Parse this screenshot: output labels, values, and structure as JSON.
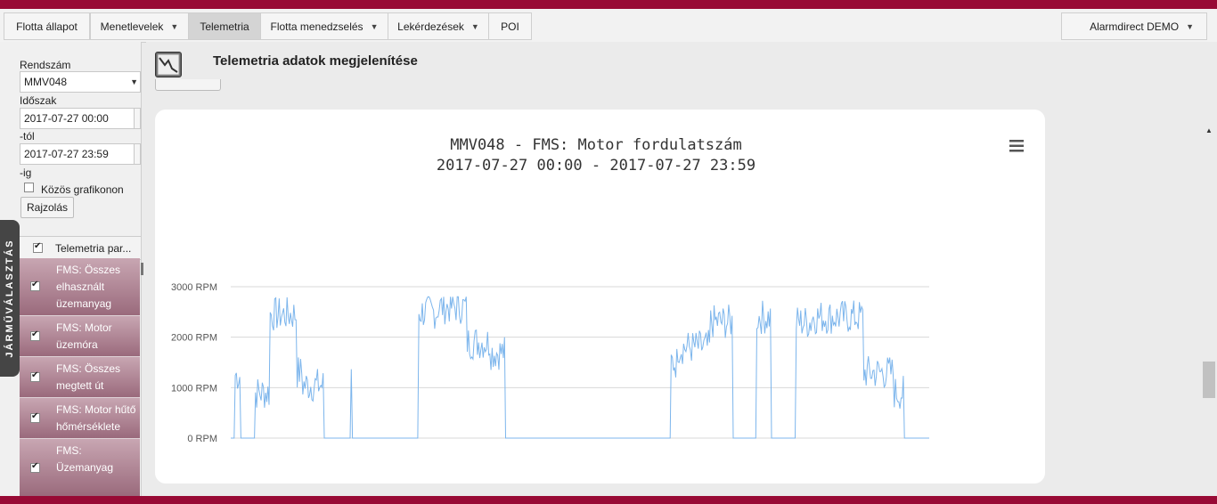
{
  "nav": {
    "items": [
      {
        "label": "Flotta állapot",
        "dropdown": false
      },
      {
        "label": "Menetlevelek",
        "dropdown": true
      },
      {
        "label": "Telemetria",
        "dropdown": false,
        "active": true
      },
      {
        "label": "Flotta menedzselés",
        "dropdown": true
      },
      {
        "label": "Lekérdezések",
        "dropdown": true
      },
      {
        "label": "POI",
        "dropdown": false
      }
    ],
    "user_label": "Alarmdirect DEMO",
    "caret": "▼"
  },
  "sidebar": {
    "tab_label": "JÁRMŰVÁLASZTÁS",
    "plate_label": "Rendszám",
    "plate_value": "MMV048",
    "period_label": "Időszak",
    "from_value": "2017-07-27 00:00",
    "from_suffix": "-tól",
    "to_value": "2017-07-27 23:59",
    "to_suffix": "-ig",
    "common_chart_label": "Közös grafikonon",
    "common_chart_checked": false,
    "draw_button": "Rajzolás",
    "table_header": "Telemetria par...",
    "params": [
      {
        "label": "FMS: Összes elhasznált üzemanyag",
        "checked": true
      },
      {
        "label": "FMS: Motor üzemóra",
        "checked": true
      },
      {
        "label": "FMS: Összes megtett út",
        "checked": true
      },
      {
        "label": "FMS: Motor hűtő hőmérséklete",
        "checked": true
      },
      {
        "label": "FMS: Üzemanyag",
        "checked": true
      }
    ]
  },
  "main": {
    "page_title": "Telemetria adatok megjelenítése",
    "page_icon": "telemetry-chart-icon"
  },
  "colors": {
    "brand": "#980a35",
    "series": "#7cb5ec",
    "param_row": "#a77a8b"
  },
  "chart_data": {
    "type": "line",
    "title": "MMV048 - FMS: Motor fordulatszám",
    "subtitle": "2017-07-27 00:00 - 2017-07-27 23:59",
    "y_unit": "RPM",
    "y_ticks": [
      0,
      1000,
      2000,
      3000
    ],
    "y_tick_labels": [
      "0 RPM",
      "1000 RPM",
      "2000 RPM",
      "3000 RPM"
    ],
    "ylim": [
      0,
      3000
    ],
    "xlim": [
      0,
      100
    ],
    "grid": true,
    "menu_icon": "hamburger-menu-icon",
    "series": [
      {
        "x": [
          0.0,
          0.13,
          0.38,
          0.52,
          0.78,
          0.91,
          1.17,
          1.3,
          1.43,
          1.69,
          1.82,
          2.08,
          2.34,
          2.47,
          2.6,
          2.86,
          2.99,
          3.25,
          3.38,
          3.51,
          3.64,
          3.9,
          4.16,
          4.29,
          4.42,
          4.68,
          4.81,
          4.94,
          5.07,
          5.2,
          5.32,
          5.45,
          5.58,
          5.71,
          5.84,
          5.97,
          6.1,
          6.23,
          6.36,
          6.49,
          6.62,
          6.75,
          6.88,
          7.01,
          7.14,
          7.27,
          7.4,
          7.53,
          7.66,
          7.79,
          7.92,
          8.05,
          8.18,
          8.31,
          8.44,
          8.57,
          8.7,
          8.83,
          8.96,
          9.09,
          9.22,
          9.35,
          9.48,
          9.61,
          9.74,
          9.87,
          10.0,
          10.26,
          10.39,
          10.52,
          10.65,
          10.78,
          10.91,
          11.04,
          11.17,
          11.3,
          11.43,
          11.56,
          11.69,
          11.82,
          11.95,
          12.08,
          12.21,
          12.34,
          12.47,
          12.6,
          12.73,
          12.86,
          13.12,
          13.25,
          13.38,
          13.51,
          13.64,
          13.77,
          13.9,
          14.16,
          14.29,
          14.42,
          14.55,
          14.68,
          14.81,
          14.94,
          15.19,
          15.32,
          15.45,
          15.58,
          15.71,
          15.84,
          16.23,
          16.88,
          17.53,
          18.18,
          18.83,
          19.48,
          20.13,
          20.78,
          21.43,
          22.08,
          22.73,
          23.38,
          24.03,
          24.68,
          25.32,
          25.97,
          26.23,
          26.36,
          26.49,
          26.62,
          26.75,
          26.88,
          27.01,
          27.14,
          27.27,
          27.4,
          27.53,
          27.66,
          27.79,
          27.92,
          28.05,
          28.18,
          28.31,
          28.44,
          28.57,
          28.7,
          28.83,
          28.96,
          29.09,
          29.22,
          29.35,
          29.48,
          29.61,
          29.74,
          29.87,
          30.0,
          30.13,
          30.26,
          30.39,
          30.52,
          30.65,
          30.78,
          30.91,
          31.04,
          31.17,
          31.3,
          31.43,
          31.56,
          31.69,
          31.82,
          31.95,
          32.08,
          32.21,
          32.34,
          32.47,
          32.6,
          32.73,
          32.86,
          32.99,
          33.12,
          33.25,
          33.38,
          33.51,
          33.64,
          33.77,
          33.9,
          34.03,
          34.16,
          34.29,
          34.42,
          34.55,
          34.68,
          34.81,
          34.94,
          35.07,
          35.19,
          35.32,
          35.45,
          35.58,
          35.71,
          35.84,
          35.97,
          36.1,
          36.23,
          36.36,
          36.49,
          36.62,
          36.75,
          36.88,
          37.01,
          37.14,
          37.27,
          37.4,
          37.53,
          37.66,
          37.79,
          37.92,
          38.05,
          38.18,
          38.31,
          38.44,
          38.57,
          38.7,
          38.83,
          38.96,
          39.09,
          39.22,
          39.35,
          39.48,
          39.61,
          39.74,
          39.87,
          40.0,
          40.13,
          40.26,
          40.39,
          40.52,
          40.65,
          40.78,
          40.91,
          41.04,
          41.17,
          41.3,
          41.43,
          41.56,
          41.69,
          41.82,
          41.95,
          42.08,
          42.21,
          42.34,
          42.47,
          42.6,
          42.73,
          42.86,
          42.99,
          43.12,
          43.25,
          43.38,
          43.51,
          43.64,
          43.77,
          43.9,
          44.03,
          44.16,
          44.29,
          44.42,
          44.55,
          44.68,
          44.81,
          44.94,
          45.07,
          45.19,
          45.32,
          45.45,
          45.58,
          45.71,
          45.84,
          45.97,
          46.1,
          46.23,
          46.36,
          46.49,
          46.62,
          46.75,
          46.88,
          47.01,
          47.14,
          47.27,
          47.4,
          47.53,
          47.66,
          47.79,
          47.92,
          48.05,
          48.18,
          48.31,
          48.44,
          48.57,
          48.7,
          48.83,
          48.96,
          49.09,
          49.22,
          49.35,
          49.48,
          49.61,
          49.74,
          49.87,
          50.0,
          50.13,
          50.26,
          50.39,
          50.52,
          50.65,
          50.78,
          50.91,
          51.04,
          51.17,
          51.3,
          51.43,
          51.56,
          51.69,
          51.82,
          51.95,
          52.08,
          52.21,
          52.34,
          52.47,
          52.6,
          52.73,
          52.86,
          52.99,
          53.12,
          53.25,
          53.38,
          53.51,
          53.64,
          53.77,
          53.9,
          54.03,
          54.16,
          54.29,
          54.42,
          54.55,
          54.68,
          54.81,
          54.94,
          55.07,
          55.19,
          55.32,
          55.45,
          55.58,
          55.71,
          55.84,
          55.97,
          56.1,
          56.23,
          56.36,
          56.49,
          56.62,
          56.75,
          56.88,
          57.01,
          57.14,
          57.27,
          57.4,
          57.53,
          57.66,
          57.79,
          57.92,
          58.05,
          58.18,
          58.31,
          58.44,
          58.57,
          58.7,
          58.83,
          58.96,
          59.09,
          59.22,
          59.35,
          59.48,
          59.61,
          59.74,
          59.87,
          60.0,
          60.13,
          60.26,
          60.39,
          60.52,
          60.65,
          60.78,
          60.91,
          61.04,
          61.17,
          61.3,
          61.43,
          61.56,
          61.69,
          61.82,
          61.95,
          62.08,
          62.21,
          62.34,
          62.47,
          62.6,
          62.73,
          62.86,
          62.99,
          63.12,
          63.25,
          63.38,
          63.51,
          63.64,
          63.77,
          63.9,
          64.03,
          64.16,
          64.29,
          64.42,
          64.55,
          64.68,
          64.81,
          64.94,
          65.07,
          65.19,
          65.32,
          65.45,
          65.58,
          65.71,
          65.84,
          65.97,
          66.1,
          66.23,
          66.36,
          66.49,
          66.62,
          66.75,
          66.88,
          67.01,
          67.14,
          67.27,
          67.4,
          67.53,
          67.66,
          67.79,
          67.92,
          68.05,
          68.18,
          68.31,
          68.44,
          68.57,
          68.7,
          68.83,
          68.96,
          69.09,
          69.22,
          69.35,
          69.48,
          69.61,
          69.74,
          69.87,
          70.0,
          70.13,
          70.26,
          70.39,
          70.52,
          70.65,
          70.78,
          70.91,
          71.04,
          71.17,
          71.3,
          71.43,
          71.56,
          71.69,
          71.82,
          71.95,
          72.08,
          72.21,
          72.34,
          72.47,
          72.6,
          72.73,
          72.86,
          72.99,
          73.12,
          73.25,
          73.38,
          73.51,
          73.64,
          73.77,
          73.9,
          74.03,
          74.16,
          74.29,
          74.42,
          74.55,
          74.68,
          74.81,
          74.94,
          75.07,
          75.19,
          75.32,
          75.45,
          75.58,
          75.71,
          75.84,
          75.97,
          76.1,
          76.23,
          76.36,
          76.49,
          76.62,
          76.75,
          76.88,
          77.01,
          77.14,
          77.27,
          77.4,
          77.53,
          77.66,
          77.79,
          77.92,
          78.05,
          78.18,
          78.31,
          78.44,
          78.57,
          78.7,
          78.83,
          78.96,
          79.09,
          79.22,
          79.35,
          79.48,
          79.61,
          79.74,
          79.87,
          80.0,
          80.13,
          80.26,
          80.39,
          80.52,
          80.65,
          80.78,
          80.91,
          81.04,
          81.17,
          81.3,
          81.43,
          81.56,
          81.69,
          81.82,
          81.95,
          82.08,
          82.21,
          82.34,
          82.47,
          82.6,
          82.73,
          82.86,
          82.99,
          83.12,
          83.25,
          83.38,
          83.51,
          83.64,
          83.77,
          83.9,
          84.03,
          84.16,
          84.29,
          84.42,
          84.55,
          84.68,
          84.81,
          84.94,
          85.07,
          85.19,
          85.32,
          85.45,
          85.58,
          85.71,
          85.84,
          85.97,
          86.1,
          86.23,
          86.36,
          86.49,
          86.62,
          86.75,
          86.88,
          87.01,
          87.14,
          87.27,
          87.4,
          87.53,
          87.66,
          87.79,
          87.92,
          88.05,
          88.18,
          88.31,
          88.44,
          88.57,
          88.7,
          88.83,
          88.96,
          89.09,
          89.22,
          89.35,
          89.48,
          89.61,
          89.74,
          89.87,
          90.0,
          90.13,
          90.26,
          90.39,
          90.52,
          90.65,
          90.78,
          90.91,
          91.04,
          91.17,
          91.3,
          91.43,
          91.56,
          91.69,
          91.82,
          91.95,
          92.08,
          92.21,
          92.34,
          92.47,
          92.6,
          92.73,
          92.86,
          92.99,
          93.12,
          93.25,
          93.38,
          93.51,
          93.64,
          93.77,
          93.9,
          94.03,
          94.16,
          94.29,
          94.42,
          94.55,
          94.68,
          94.81,
          94.94,
          95.07,
          95.19,
          95.32,
          95.45,
          95.58,
          95.71,
          95.84,
          95.97,
          96.1,
          96.23,
          96.36,
          96.49,
          96.62,
          96.75,
          96.88,
          97.01,
          97.14,
          97.27,
          97.4,
          97.53,
          97.66,
          97.79,
          97.92,
          98.05,
          98.18,
          98.31,
          98.44,
          98.57,
          98.7,
          98.83,
          98.96,
          99.09,
          99.22,
          99.35,
          99.48,
          99.61,
          99.74,
          99.87,
          100.0
        ],
        "y_note": "omitted"
      }
    ]
  }
}
